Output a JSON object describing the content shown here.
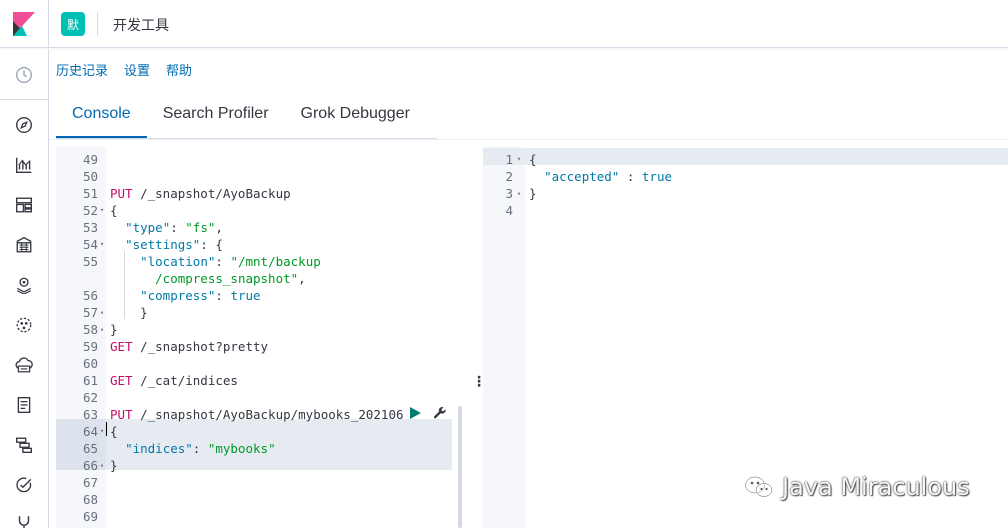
{
  "header": {
    "space_initial": "默",
    "app_title": "开发工具"
  },
  "topmenu": [
    "历史记录",
    "设置",
    "帮助"
  ],
  "tabs": [
    {
      "label": "Console",
      "active": true
    },
    {
      "label": "Search Profiler",
      "active": false
    },
    {
      "label": "Grok Debugger",
      "active": false
    }
  ],
  "nav_icons": [
    "clock-icon",
    "discover-icon",
    "visualize-icon",
    "dashboard-icon",
    "canvas-icon",
    "maps-icon",
    "ml-icon",
    "infrastructure-icon",
    "logs-icon",
    "apm-icon",
    "uptime-icon",
    "dev-tools-icon"
  ],
  "editor": {
    "lines": [
      {
        "n": "49",
        "fold": "",
        "tokens": []
      },
      {
        "n": "50",
        "fold": "",
        "tokens": []
      },
      {
        "n": "51",
        "fold": "",
        "tokens": [
          [
            "kw",
            "PUT"
          ],
          [
            "url",
            " /_snapshot/AyoBackup"
          ]
        ]
      },
      {
        "n": "52",
        "fold": "▾",
        "tokens": [
          [
            "punct",
            "{"
          ]
        ]
      },
      {
        "n": "53",
        "fold": "",
        "tokens": [
          [
            "punct",
            "  "
          ],
          [
            "key",
            "\"type\""
          ],
          [
            "punct",
            ": "
          ],
          [
            "str",
            "\"fs\""
          ],
          [
            "punct",
            ","
          ]
        ]
      },
      {
        "n": "54",
        "fold": "▾",
        "tokens": [
          [
            "punct",
            "  "
          ],
          [
            "key",
            "\"settings\""
          ],
          [
            "punct",
            ": {"
          ]
        ]
      },
      {
        "n": "55",
        "fold": "",
        "tokens": [
          [
            "punct",
            "    "
          ],
          [
            "key",
            "\"location\""
          ],
          [
            "punct",
            ": "
          ],
          [
            "str",
            "\"/mnt/backup"
          ]
        ]
      },
      {
        "n": "",
        "fold": "",
        "tokens": [
          [
            "punct",
            "      "
          ],
          [
            "str",
            "/compress_snapshot\""
          ],
          [
            "punct",
            ","
          ]
        ]
      },
      {
        "n": "56",
        "fold": "",
        "tokens": [
          [
            "punct",
            "    "
          ],
          [
            "key",
            "\"compress\""
          ],
          [
            "punct",
            ": "
          ],
          [
            "lit",
            "true"
          ]
        ]
      },
      {
        "n": "57",
        "fold": "▴",
        "tokens": [
          [
            "punct",
            "    }"
          ]
        ]
      },
      {
        "n": "58",
        "fold": "▴",
        "tokens": [
          [
            "punct",
            "}"
          ]
        ]
      },
      {
        "n": "59",
        "fold": "",
        "tokens": [
          [
            "kw",
            "GET"
          ],
          [
            "url",
            " /_snapshot?pretty"
          ]
        ]
      },
      {
        "n": "60",
        "fold": "",
        "tokens": []
      },
      {
        "n": "61",
        "fold": "",
        "tokens": [
          [
            "kw",
            "GET"
          ],
          [
            "url",
            " /_cat/indices"
          ]
        ]
      },
      {
        "n": "62",
        "fold": "",
        "tokens": []
      },
      {
        "n": "63",
        "fold": "",
        "tokens": [
          [
            "kw",
            "PUT"
          ],
          [
            "url",
            " /_snapshot/AyoBackup/mybooks_202106"
          ]
        ]
      },
      {
        "n": "64",
        "fold": "▾",
        "tokens": [
          [
            "punct",
            "{"
          ]
        ]
      },
      {
        "n": "65",
        "fold": "",
        "tokens": [
          [
            "punct",
            "  "
          ],
          [
            "key",
            "\"indices\""
          ],
          [
            "punct",
            ": "
          ],
          [
            "str",
            "\"mybooks\""
          ]
        ]
      },
      {
        "n": "66",
        "fold": "▴",
        "tokens": [
          [
            "punct",
            "}"
          ]
        ]
      },
      {
        "n": "67",
        "fold": "",
        "tokens": []
      },
      {
        "n": "68",
        "fold": "",
        "tokens": []
      },
      {
        "n": "69",
        "fold": "",
        "tokens": []
      }
    ]
  },
  "output": {
    "lines": [
      {
        "n": "1",
        "fold": "▾",
        "tokens": [
          [
            "punct",
            "{"
          ]
        ]
      },
      {
        "n": "2",
        "fold": "",
        "tokens": [
          [
            "punct",
            "  "
          ],
          [
            "key",
            "\"accepted\""
          ],
          [
            "punct",
            " : "
          ],
          [
            "lit",
            "true"
          ]
        ]
      },
      {
        "n": "3",
        "fold": "▴",
        "tokens": [
          [
            "punct",
            "}"
          ]
        ]
      },
      {
        "n": "4",
        "fold": "",
        "tokens": []
      }
    ]
  },
  "watermark": "Java Miraculous",
  "colors": {
    "accent": "#006bb4",
    "method": "#c80a68",
    "string": "#009926",
    "key": "#0079a5",
    "space_avatar": "#00bfb3"
  }
}
